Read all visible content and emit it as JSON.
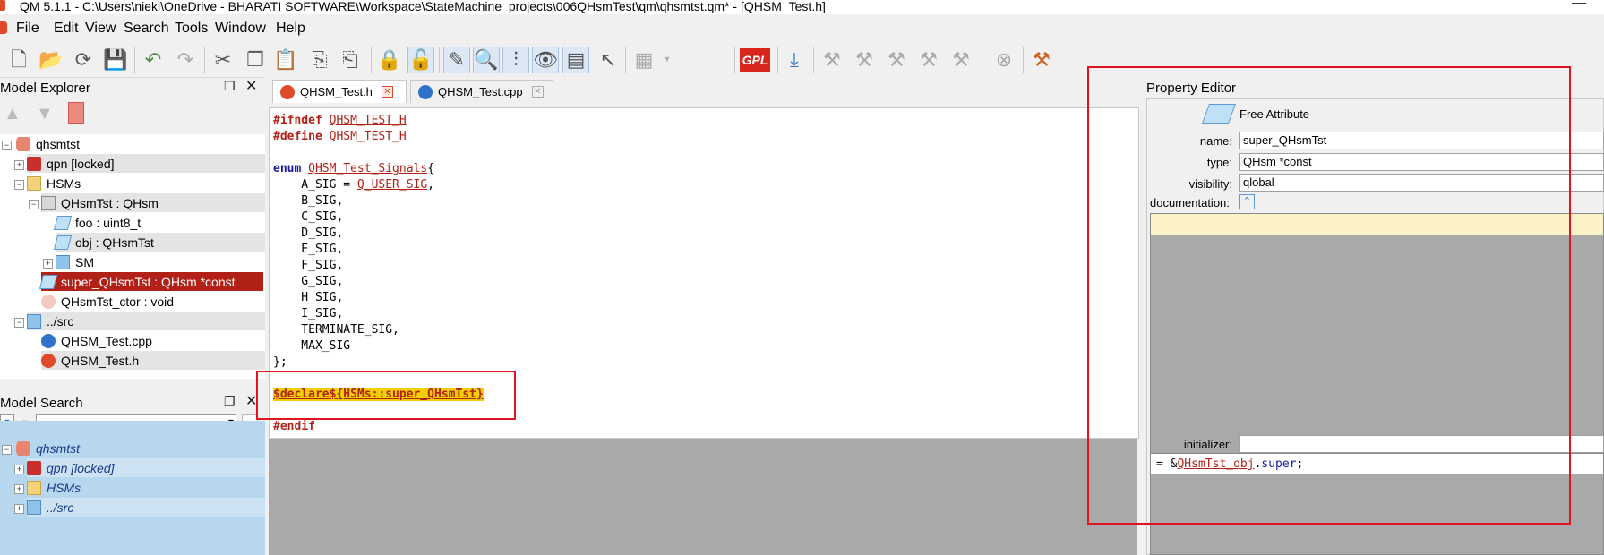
{
  "window": {
    "title": "QM 5.1.1 - C:\\Users\\nieki\\OneDrive - BHARATI SOFTWARE\\Workspace\\StateMachine_projects\\006QHsmTest\\qm\\qhsmtst.qm* - [QHSM_Test.h]"
  },
  "menu": [
    "File",
    "Edit",
    "View",
    "Search",
    "Tools",
    "Window",
    "Help"
  ],
  "toolbar": {
    "gpl_label": "GPL"
  },
  "model_explorer": {
    "title": "Model Explorer",
    "tree": [
      {
        "label": "qhsmtst"
      },
      {
        "label": "qpn [locked]"
      },
      {
        "label": "HSMs"
      },
      {
        "label": "QHsmTst : QHsm"
      },
      {
        "label": "foo : uint8_t"
      },
      {
        "label": "obj : QHsmTst"
      },
      {
        "label": "SM"
      },
      {
        "label": "super_QHsmTst : QHsm *const"
      },
      {
        "label": "QHsmTst_ctor : void"
      },
      {
        "label": "../src"
      },
      {
        "label": "QHSM_Test.cpp"
      },
      {
        "label": "QHSM_Test.h"
      }
    ]
  },
  "model_search": {
    "title": "Model Search",
    "results": [
      {
        "label": "qhsmtst"
      },
      {
        "label": "qpn [locked]"
      },
      {
        "label": "HSMs"
      },
      {
        "label": "../src"
      }
    ]
  },
  "tabs": [
    {
      "label": "QHSM_Test.h",
      "active": true
    },
    {
      "label": "QHSM_Test.cpp",
      "active": false
    }
  ],
  "editor": {
    "lines": {
      "l1_kw": "#ifndef",
      "l1_id": "QHSM_TEST_H",
      "l2_kw": "#define",
      "l2_id": "QHSM_TEST_H",
      "l4_kw": "enum",
      "l4_id": "QHSM_Test_Signals",
      "l4_rest": "{",
      "l5_pre": "    A_SIG = ",
      "l5_id": "Q_USER_SIG",
      "l5_rest": ",",
      "signals": [
        "    B_SIG,",
        "    C_SIG,",
        "    D_SIG,",
        "    E_SIG,",
        "    F_SIG,",
        "    G_SIG,",
        "    H_SIG,",
        "    I_SIG,",
        "    TERMINATE_SIG,",
        "    MAX_SIG"
      ],
      "close": "};",
      "declare": "$declare${HSMs::super_QHsmTst}",
      "endif": "#endif"
    }
  },
  "property_editor": {
    "title": "Property Editor",
    "kind": "Free Attribute",
    "name_label": "name:",
    "name_value": "super_QHsmTst",
    "type_label": "type:",
    "type_value": "QHsm *const",
    "visibility_label": "visibility:",
    "visibility_value": "qlobal",
    "documentation_label": "documentation:",
    "initializer_label": "initializer:",
    "initializer_code": {
      "pre": "= &",
      "id": "QHsmTst_obj",
      "dot": ".",
      "member": "super",
      "end": ";"
    }
  }
}
